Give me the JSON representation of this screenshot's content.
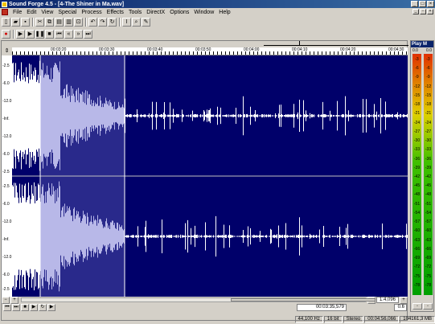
{
  "window": {
    "title": "Sound Forge 4.5 - [4-The Shiner in Ma.wav]"
  },
  "menu": [
    "File",
    "Edit",
    "View",
    "Special",
    "Process",
    "Effects",
    "Tools",
    "DirectX",
    "Options",
    "Window",
    "Help"
  ],
  "ruler": {
    "labels": [
      "00:03:20",
      "00:03:30",
      "00:03:40",
      "00:03:50",
      "00:04:00",
      "00:04:10",
      "00:04:20",
      "00:04:30"
    ]
  },
  "db_scale": {
    "channel1": [
      "-2.5",
      "-6.0",
      "-12.0",
      "-Inf.",
      "-12.0",
      "-6.0",
      "-2.5"
    ],
    "channel2": [
      "-2.5",
      "-6.0",
      "-12.0",
      "-Inf.",
      "-12.0",
      "-6.0",
      "-2.5"
    ]
  },
  "zoom": {
    "ratio": "1:4,096",
    "level": "0.6"
  },
  "position": {
    "cursor": "00:03:35,579"
  },
  "status": {
    "sample_rate": "44,100 Hz",
    "bit_depth": "16 bit",
    "channels": "Stereo",
    "length": "00:04:56,066",
    "size": "104161,3 MB"
  },
  "meter": {
    "title": "Play M",
    "peak_left": "0.0",
    "peak_right": "0.0",
    "scale": [
      "-3",
      "-6",
      "-9",
      "-12",
      "-15",
      "-18",
      "-21",
      "-24",
      "-27",
      "-30",
      "-33",
      "-36",
      "-39",
      "-42",
      "-45",
      "-48",
      "-51",
      "-54",
      "-57",
      "-60",
      "-63",
      "-66",
      "-69",
      "-72",
      "-75",
      "-78"
    ]
  },
  "colors": {
    "waveform_bg": "#00006a",
    "waveform": "#ffffff",
    "highlight": "#8080c0",
    "titlebar": "#0a246a"
  }
}
